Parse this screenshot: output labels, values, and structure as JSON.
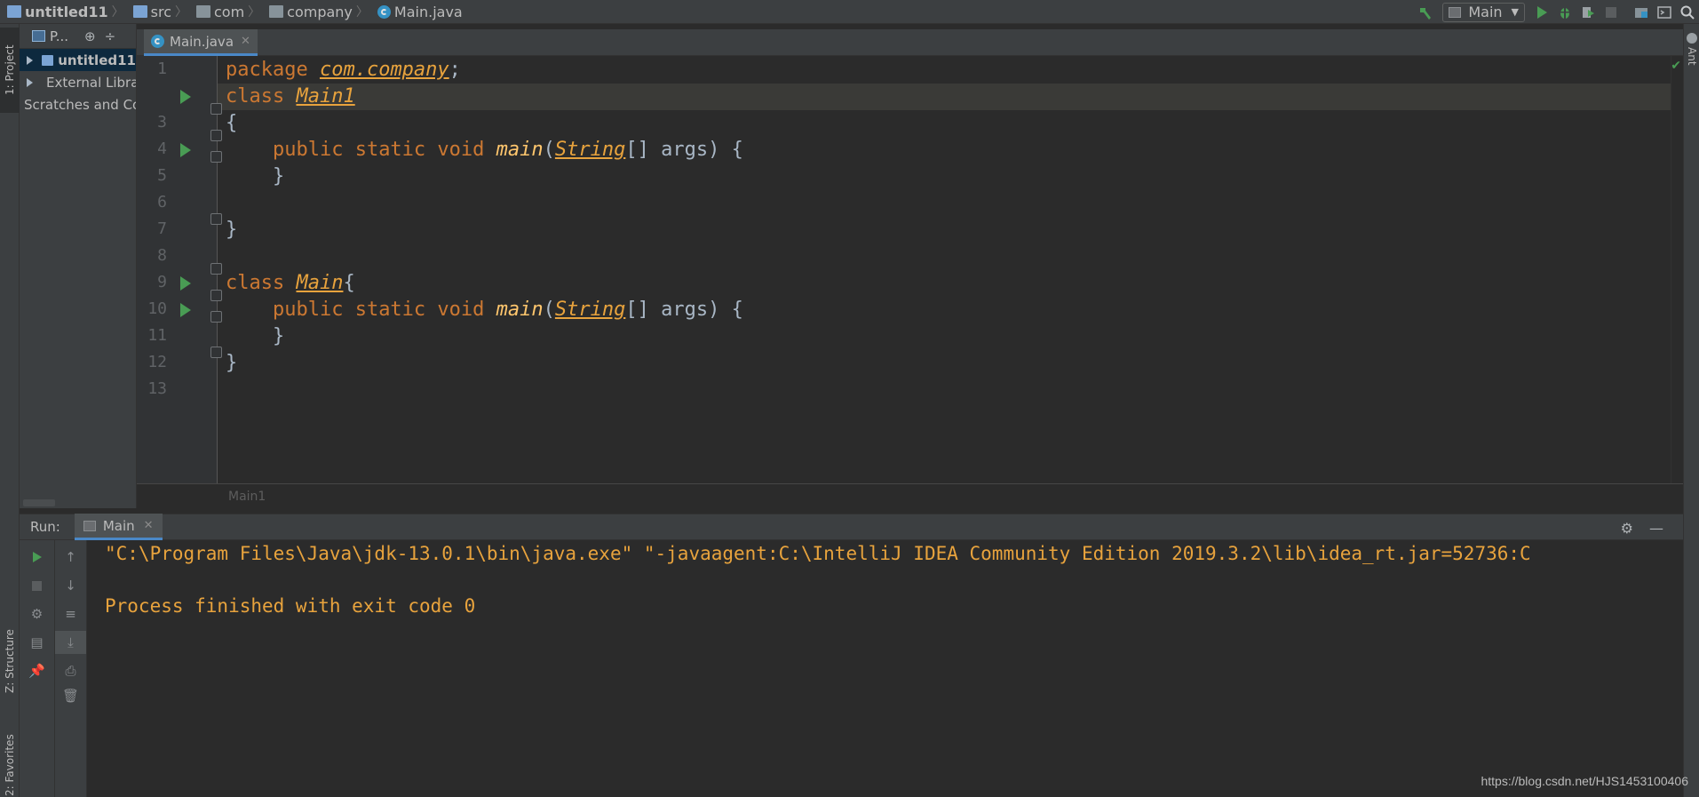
{
  "navbar": {
    "crumbs": [
      "untitled11",
      "src",
      "com",
      "company",
      "Main.java"
    ]
  },
  "toolbar": {
    "run_config": "Main",
    "icons": [
      "hammer-icon",
      "run-icon",
      "debug-icon",
      "coverage-icon",
      "stop-icon",
      "project-structure-icon",
      "terminal-icon",
      "search-icon"
    ]
  },
  "left_strip": {
    "project_tab": "1: Project",
    "structure_tab": "Z: Structure",
    "favorites_tab": "2: Favorites"
  },
  "right_strip": {
    "ant_tab": "Ant"
  },
  "project_panel": {
    "header": "P...",
    "items": [
      {
        "label": "untitled11",
        "bold": true
      },
      {
        "label": "External Libraries"
      },
      {
        "label": "Scratches and Consoles"
      }
    ]
  },
  "editor": {
    "tab_label": "Main.java",
    "breadcrumb": "Main1",
    "line_numbers": [
      "1",
      "",
      "3",
      "4",
      "5",
      "6",
      "7",
      "8",
      "9",
      "10",
      "11",
      "12",
      "13"
    ],
    "run_marker_lines": [
      2,
      4,
      9,
      10
    ]
  },
  "code": {
    "l1_kw": "package ",
    "l1_pkg": "com.company",
    "l1_end": ";",
    "l2_kw": "class ",
    "l2_name": "Main1",
    "l3": "{",
    "l4_indent": "    ",
    "l4_kw": "public static void ",
    "l4_fn": "main",
    "l4_open": "(",
    "l4_type": "String",
    "l4_rest": "[] ",
    "l4_param": "args",
    "l4_close": ") {",
    "l5": "    }",
    "l7": "}",
    "l9_kw": "class ",
    "l9_name": "Main",
    "l9_brace": "{",
    "l10_indent": "    ",
    "l10_kw": "public static void ",
    "l10_fn": "main",
    "l10_open": "(",
    "l10_type": "String",
    "l10_rest": "[] ",
    "l10_param": "args",
    "l10_close": ") {",
    "l11": "    }",
    "l12": "}"
  },
  "run_panel": {
    "label": "Run:",
    "tab": "Main",
    "console_lines": [
      "\"C:\\Program Files\\Java\\jdk-13.0.1\\bin\\java.exe\" \"-javaagent:C:\\IntelliJ IDEA Community Edition 2019.3.2\\lib\\idea_rt.jar=52736:C",
      "Process finished with exit code 0"
    ]
  },
  "watermark": "https://blog.csdn.net/HJS1453100406",
  "colors": {
    "keyword": "#cc7832",
    "type": "#e8a33d",
    "run_green": "#499c54",
    "console_text": "#e8a33d",
    "tab_underline": "#4a88c7"
  }
}
